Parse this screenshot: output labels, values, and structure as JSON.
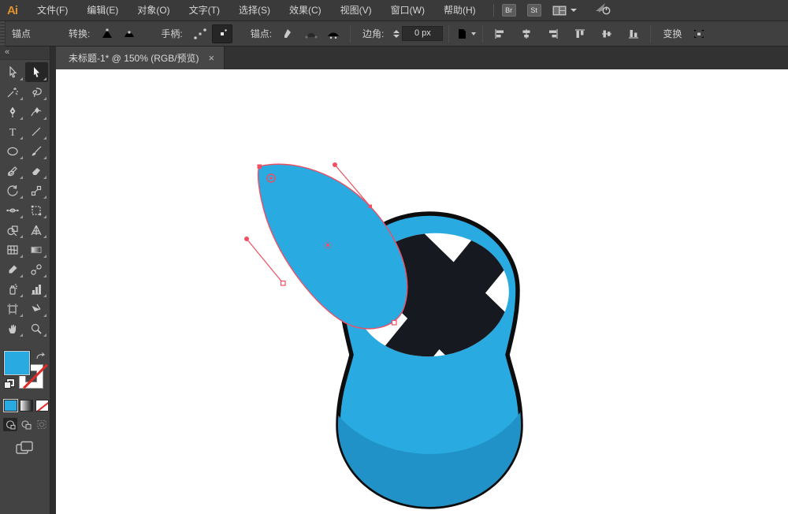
{
  "app": {
    "logo_text": "Ai"
  },
  "menubar": {
    "items": [
      "文件(F)",
      "编辑(E)",
      "对象(O)",
      "文字(T)",
      "选择(S)",
      "效果(C)",
      "视图(V)",
      "窗口(W)",
      "帮助(H)"
    ],
    "bridge_label": "Br",
    "stock_label": "St"
  },
  "controlbar": {
    "context_label": "锚点",
    "convert_label": "转换:",
    "handles_label": "手柄:",
    "anchors_label": "锚点:",
    "corner_label": "边角:",
    "corner_value": "0 px",
    "transform_label": "变换"
  },
  "tabbar": {
    "title": "未标题-1* @ 150% (RGB/预览)",
    "close_glyph": "×"
  },
  "toolbar": {
    "collapse_glyph": "«",
    "active_tool": "direct-selection-tool",
    "fill_color": "#29ABE2",
    "stroke_style": "none",
    "tool_icon_names": [
      "selection-tool",
      "direct-selection-tool",
      "magic-wand-tool",
      "lasso-tool",
      "pen-tool",
      "curvature-tool",
      "type-tool",
      "line-segment-tool",
      "ellipse-tool",
      "paintbrush-tool",
      "pencil-tool",
      "eraser-tool",
      "rotate-tool",
      "scale-tool",
      "width-tool",
      "free-transform-tool",
      "shape-builder-tool",
      "perspective-grid-tool",
      "mesh-tool",
      "gradient-tool",
      "eyedropper-tool",
      "blend-tool",
      "symbol-sprayer-tool",
      "column-graph-tool",
      "artboard-tool",
      "slice-tool",
      "hand-tool",
      "zoom-tool"
    ]
  },
  "artwork": {
    "body_color": "#29ABE2",
    "shade_color": "#2092C8",
    "outline_color": "#0d0d0d",
    "opening_color": "#ffffff",
    "x_shape_color": "#161920",
    "selection_color": "#ee4f62"
  }
}
